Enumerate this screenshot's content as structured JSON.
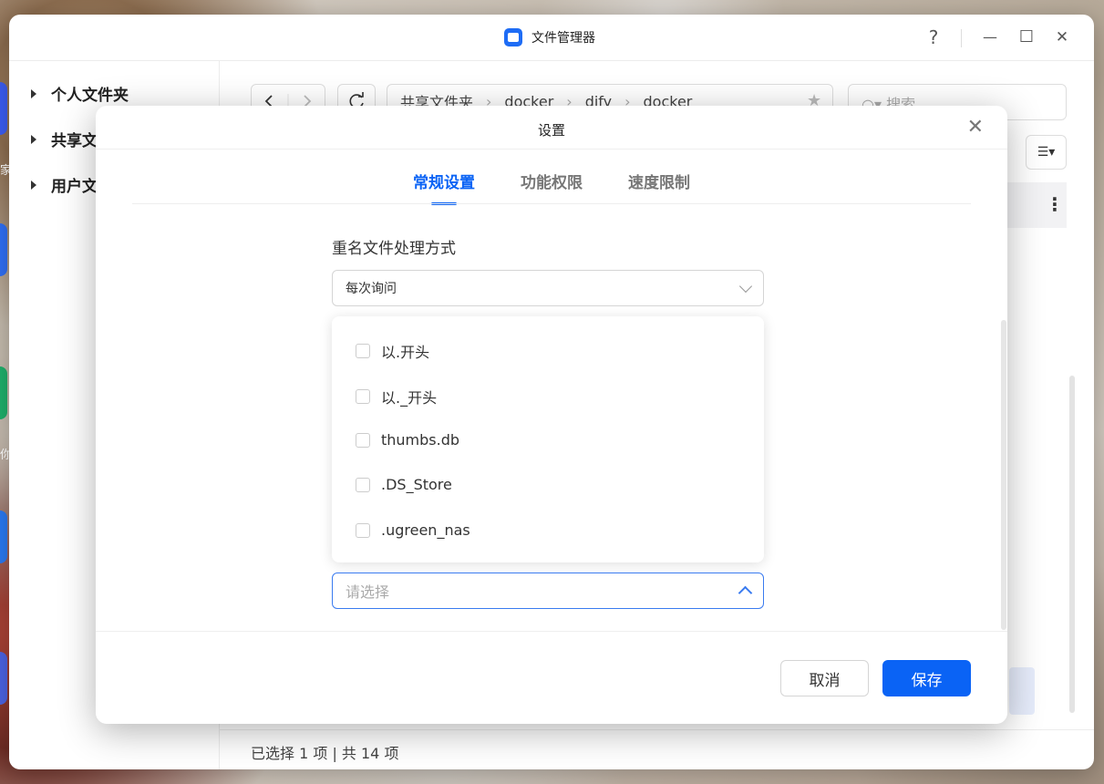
{
  "window": {
    "title": "文件管理器",
    "help_icon": "?",
    "minimize_icon": "—",
    "maximize_icon": "☐",
    "close_icon": "✕"
  },
  "desktop_fragments": [
    "家",
    "你"
  ],
  "sidebar": {
    "items": [
      {
        "label": "个人文件夹"
      },
      {
        "label": "共享文"
      },
      {
        "label": "用户文"
      }
    ]
  },
  "toolbar": {
    "breadcrumb": [
      "共享文件夹",
      "docker",
      "dify",
      "docker"
    ],
    "search_placeholder": "搜索"
  },
  "status": {
    "text": "已选择 1 项 | 共 14 项"
  },
  "dialog": {
    "title": "设置",
    "tabs": [
      {
        "label": "常规设置",
        "active": true
      },
      {
        "label": "功能权限",
        "active": false
      },
      {
        "label": "速度限制",
        "active": false
      }
    ],
    "rename_label": "重名文件处理方式",
    "rename_value": "每次询问",
    "filter_placeholder": "请选择",
    "options": [
      {
        "label": "以.开头",
        "checked": false
      },
      {
        "label": "以._开头",
        "checked": false
      },
      {
        "label": "thumbs.db",
        "checked": false
      },
      {
        "label": ".DS_Store",
        "checked": false
      },
      {
        "label": ".ugreen_nas",
        "checked": false
      }
    ],
    "cancel_label": "取消",
    "save_label": "保存"
  },
  "colors": {
    "accent": "#0a63f5"
  }
}
